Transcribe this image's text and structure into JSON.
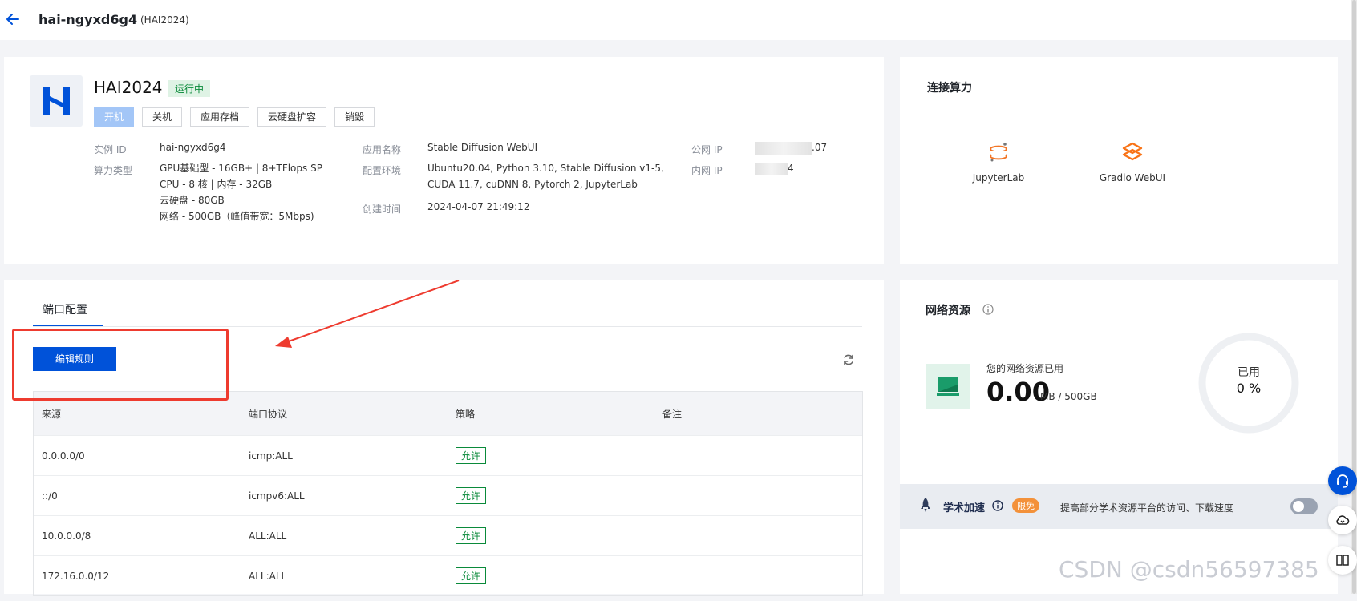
{
  "topbar": {
    "title": "hai-ngyxd6g4",
    "subtitle": "(HAI2024)"
  },
  "instance": {
    "name": "HAI2024",
    "status": "运行中",
    "actions": [
      "开机",
      "关机",
      "应用存档",
      "云硬盘扩容",
      "销毁"
    ],
    "labels": {
      "id": "实例 ID",
      "compute": "算力类型",
      "app": "应用名称",
      "env": "配置环境",
      "created": "创建时间",
      "public_ip": "公网 IP",
      "private_ip": "内网 IP"
    },
    "id": "hai-ngyxd6g4",
    "compute": [
      "GPU基础型 - 16GB+ | 8+TFlops SP",
      "CPU - 8 核 | 内存 - 32GB",
      "云硬盘 - 80GB",
      "网络 - 500GB（峰值带宽：5Mbps)"
    ],
    "app": "Stable Diffusion WebUI",
    "env": [
      "Ubuntu20.04, Python 3.10, Stable Diffusion v1-5,",
      "CUDA 11.7, cuDNN 8, Pytorch 2, JupyterLab"
    ],
    "created": "2024-04-07 21:49:12",
    "public_ip_tail": ".07",
    "private_ip_tail": "4"
  },
  "connect": {
    "title": "连接算力",
    "tools": [
      "JupyterLab",
      "Gradio WebUI"
    ]
  },
  "port": {
    "tab": "端口配置",
    "edit_button": "编辑规则",
    "columns": [
      "来源",
      "端口协议",
      "策略",
      "备注"
    ],
    "rows": [
      {
        "source": "0.0.0.0/0",
        "protocol": "icmp:ALL",
        "policy": "允许",
        "note": ""
      },
      {
        "source": "::/0",
        "protocol": "icmpv6:ALL",
        "policy": "允许",
        "note": ""
      },
      {
        "source": "10.0.0.0/8",
        "protocol": "ALL:ALL",
        "policy": "允许",
        "note": ""
      },
      {
        "source": "172.16.0.0/12",
        "protocol": "ALL:ALL",
        "policy": "允许",
        "note": ""
      }
    ]
  },
  "network": {
    "title": "网络资源",
    "used_label": "您的网络资源已用",
    "used_value": "0.00",
    "used_unit": "MB / 500GB",
    "ring_label": "已用",
    "ring_value": "0 %",
    "used_fraction": 0
  },
  "academic": {
    "title": "学术加速",
    "badge": "限免",
    "desc": "提高部分学术资源平台的访问、下载速度",
    "enabled": false
  },
  "watermark": "CSDN @csdn56597385",
  "colors": {
    "primary": "#0052d9",
    "success": "#0a8a3a",
    "annotation": "#ee3b2f",
    "badge": "#f3913a"
  }
}
